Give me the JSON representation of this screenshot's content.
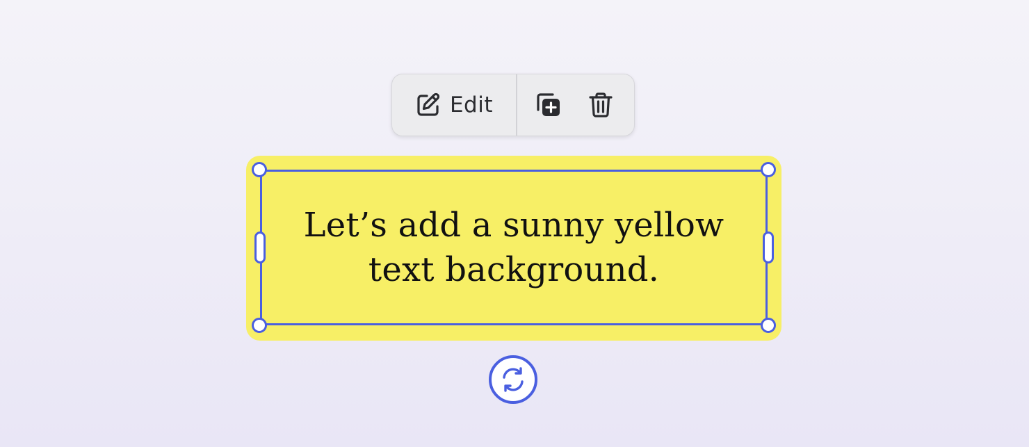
{
  "toolbar": {
    "edit_label": "Edit",
    "icons": {
      "edit": "pencil-square-icon",
      "duplicate": "duplicate-icon",
      "delete": "trash-icon"
    }
  },
  "text_box": {
    "text": "Let’s add a sunny yellow text background.",
    "background_color": "#f7ef66",
    "selection_color": "#4a5fe0"
  },
  "rotate": {
    "icon": "rotate-arrows-icon"
  }
}
